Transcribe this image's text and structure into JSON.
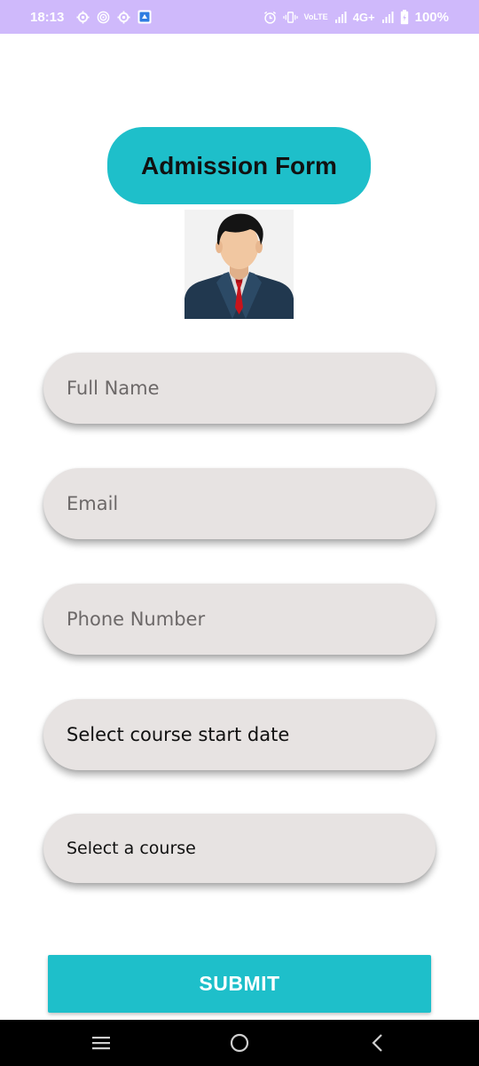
{
  "status_bar": {
    "time": "18:13",
    "volte_label": "VoLTE",
    "network_label": "4G+",
    "battery_percent": "100%",
    "icons": [
      "settings-icon",
      "target-icon",
      "settings-icon",
      "app-icon",
      "alarm-icon",
      "vibrate-icon",
      "volte-icon",
      "signal-icon",
      "signal-4g-icon",
      "battery-icon"
    ]
  },
  "form": {
    "title": "Admission Form",
    "avatar_icon": "person-avatar-icon",
    "full_name_placeholder": "Full Name",
    "email_placeholder": "Email",
    "phone_placeholder": "Phone Number",
    "date_picker_label": "Select course start date",
    "course_select_label": "Select a course",
    "submit_label": "SUBMIT"
  },
  "colors": {
    "status_bar": "#cfb9fb",
    "accent": "#1ebfca",
    "field_bg": "#e7e3e2",
    "nav_bar": "#000000"
  },
  "nav_bar": {
    "icons": [
      "menu-icon",
      "home-icon",
      "back-icon"
    ]
  }
}
